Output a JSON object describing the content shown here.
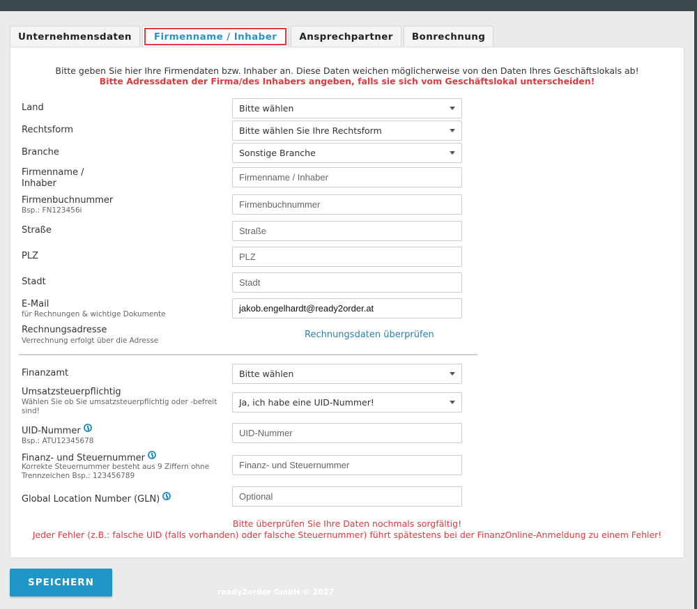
{
  "tabs": [
    {
      "label": "Unternehmensdaten",
      "active": false
    },
    {
      "label": "Firmenname / Inhaber",
      "active": true
    },
    {
      "label": "Ansprechpartner",
      "active": false
    },
    {
      "label": "Bonrechnung",
      "active": false
    }
  ],
  "intro": {
    "line1": "Bitte geben Sie hier Ihre Firmendaten bzw. Inhaber an. Diese Daten weichen möglicherweise von den Daten Ihres Geschäftslokals ab!",
    "line2": "Bitte Adressdaten der Firma/des Inhabers angeben, falls sie sich vom Geschäftslokal unterscheiden!"
  },
  "fields": {
    "land": {
      "label": "Land",
      "value": "Bitte wählen"
    },
    "rechtsform": {
      "label": "Rechtsform",
      "value": "Bitte wählen Sie Ihre Rechtsform"
    },
    "branche": {
      "label": "Branche",
      "value": "Sonstige Branche"
    },
    "firmenname": {
      "label_1": "Firmenname /",
      "label_2": "Inhaber",
      "placeholder": "Firmenname / Inhaber"
    },
    "firmenbuch": {
      "label": "Firmenbuchnummer",
      "hint": "Bsp.: FN123456i",
      "placeholder": "Firmenbuchnummer"
    },
    "strasse": {
      "label": "Straße",
      "placeholder": "Straße"
    },
    "plz": {
      "label": "PLZ",
      "placeholder": "PLZ"
    },
    "stadt": {
      "label": "Stadt",
      "placeholder": "Stadt"
    },
    "email": {
      "label": "E-Mail",
      "hint": "für Rechnungen & wichtige Dokumente",
      "value": "jakob.engelhardt@ready2order.at"
    },
    "rechnungsadresse": {
      "label": "Rechnungsadresse",
      "hint": "Verrechnung erfolgt über die Adresse",
      "link": "Rechnungsdaten überprüfen"
    },
    "finanzamt": {
      "label": "Finanzamt",
      "value": "Bitte wählen"
    },
    "ust": {
      "label": "Umsatzsteuerpflichtig",
      "hint_1": "Wählen Sie ob Sie umsatzsteuerpflichtig oder -befreit",
      "hint_2": "sind!",
      "value": "Ja, ich habe eine UID-Nummer!"
    },
    "uid": {
      "label": "UID-Nummer",
      "hint": "Bsp.: ATU12345678",
      "placeholder": "UID-Nummer"
    },
    "steuernummer": {
      "label": "Finanz- und Steuernummer",
      "hint_1": "Korrekte Steuernummer besteht aus 9 Ziffern ohne",
      "hint_2": "Trennzeichen Bsp.: 123456789",
      "placeholder": "Finanz- und Steuernummer"
    },
    "gln": {
      "label": "Global Location Number (GLN)",
      "placeholder": "Optional"
    }
  },
  "warning": {
    "line1": "Bitte überprüfen Sie Ihre Daten nochmals sorgfältig!",
    "line2": "Jeder Fehler (z.B.: falsche UID (falls vorhanden) oder falsche Steuernummer) führt spätestens bei der FinanzOnline-Anmeldung zu einem Fehler!"
  },
  "save_label": "SPEICHERN",
  "footer": "ready2order GmbH © 2017",
  "colors": {
    "accent": "#1f96c6",
    "error": "#e0393e",
    "topbar": "#3c474d"
  }
}
